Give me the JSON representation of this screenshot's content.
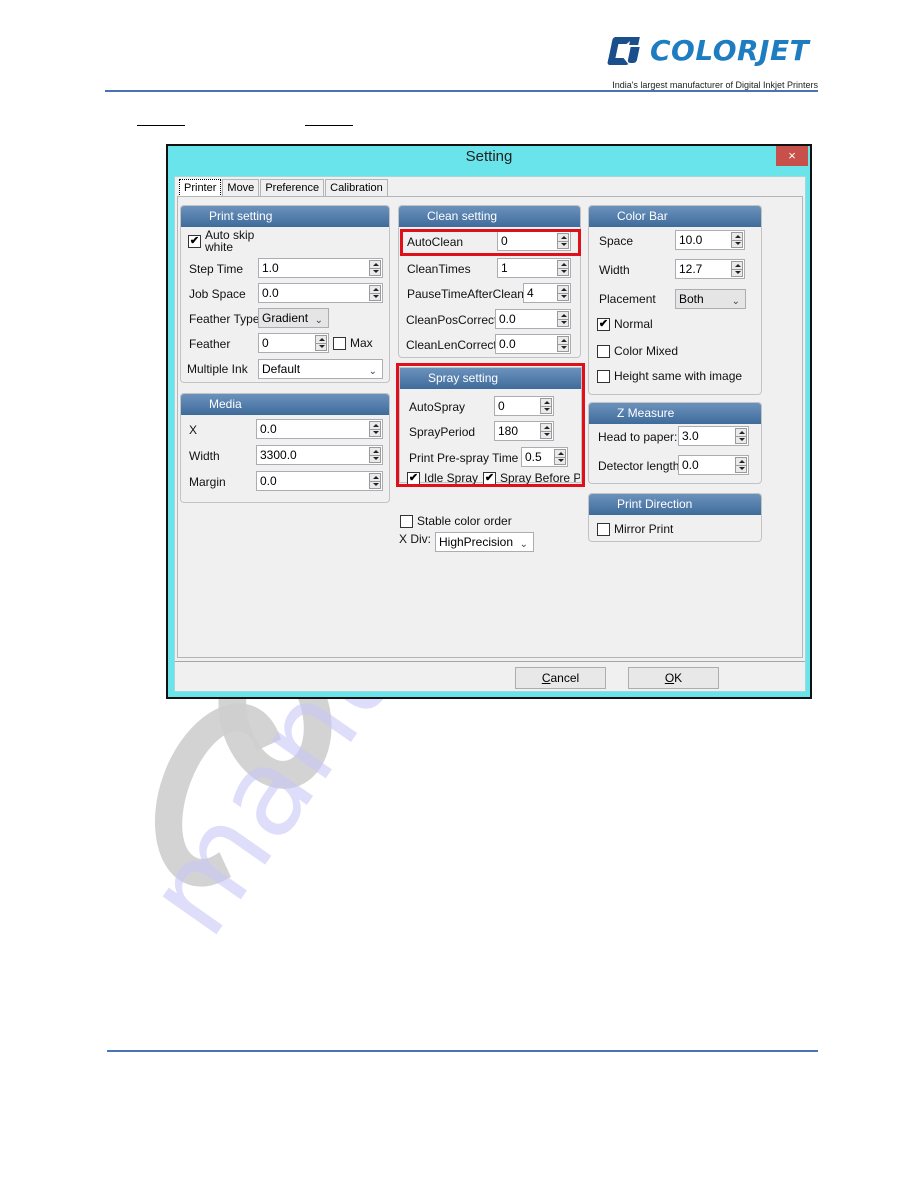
{
  "page": {
    "brand": "COLORJET",
    "tagline": "India's largest manufacturer of Digital Inkjet Printers",
    "watermark": "manuals"
  },
  "dialog": {
    "title": "Setting",
    "close_icon": "×",
    "tabs": [
      {
        "label": "Printer",
        "active": true
      },
      {
        "label": "Move",
        "active": false
      },
      {
        "label": "Preference",
        "active": false
      },
      {
        "label": "Calibration",
        "active": false
      }
    ],
    "print_setting": {
      "title": "Print setting",
      "auto_skip_white": {
        "label_line1": "Auto skip",
        "label_line2": "white",
        "checked": true
      },
      "step_time": {
        "label": "Step Time",
        "value": "1.0"
      },
      "job_space": {
        "label": "Job Space",
        "value": "0.0"
      },
      "feather_type": {
        "label": "Feather Type",
        "value": "Gradient"
      },
      "feather": {
        "label": "Feather",
        "value": "0"
      },
      "max": {
        "label": "Max",
        "checked": false
      },
      "multiple_ink": {
        "label": "Multiple Ink",
        "value": "Default"
      }
    },
    "media": {
      "title": "Media",
      "x": {
        "label": "X",
        "value": "0.0"
      },
      "width": {
        "label": "Width",
        "value": "3300.0"
      },
      "margin": {
        "label": "Margin",
        "value": "0.0"
      }
    },
    "clean_setting": {
      "title": "Clean setting",
      "auto_clean": {
        "label": "AutoClean",
        "value": "0"
      },
      "clean_times": {
        "label": "CleanTimes",
        "value": "1"
      },
      "pause_time_after_clean": {
        "label": "PauseTimeAfterClean",
        "value": "4"
      },
      "clean_pos_correct": {
        "label": "CleanPosCorrect",
        "value": "0.0"
      },
      "clean_len_correct": {
        "label": "CleanLenCorrect",
        "value": "0.0"
      }
    },
    "spray_setting": {
      "title": "Spray setting",
      "auto_spray": {
        "label": "AutoSpray",
        "value": "0"
      },
      "spray_period": {
        "label": "SprayPeriod",
        "value": "180"
      },
      "print_pre_spray_time": {
        "label": "Print Pre-spray Time",
        "value": "0.5"
      },
      "idle_spray": {
        "label": "Idle Spray",
        "checked": true
      },
      "spray_before_print": {
        "label": "Spray Before Pri",
        "checked": true
      }
    },
    "stable_color_order": {
      "label": "Stable color order",
      "checked": false
    },
    "x_div": {
      "label": "X Div:",
      "value": "HighPrecision"
    },
    "color_bar": {
      "title": "Color Bar",
      "space": {
        "label": "Space",
        "value": "10.0"
      },
      "width": {
        "label": "Width",
        "value": "12.7"
      },
      "placement": {
        "label": "Placement",
        "value": "Both"
      },
      "normal": {
        "label": "Normal",
        "checked": true
      },
      "color_mixed": {
        "label": "Color Mixed",
        "checked": false
      },
      "height_same": {
        "label": "Height same with image",
        "checked": false
      }
    },
    "z_measure": {
      "title": "Z Measure",
      "head_to_paper": {
        "label": "Head to paper:",
        "value": "3.0"
      },
      "detector_length": {
        "label": "Detector length:",
        "value": "0.0"
      }
    },
    "print_direction": {
      "title": "Print Direction",
      "mirror_print": {
        "label": "Mirror Print",
        "checked": false
      }
    },
    "buttons": {
      "cancel_first": "C",
      "cancel_rest": "ancel",
      "ok_first": "O",
      "ok_rest": "K"
    },
    "highlight_color": "#e0101a",
    "title_bar_color": "#68e4ea",
    "group_header_color": "#4f7aa8"
  }
}
